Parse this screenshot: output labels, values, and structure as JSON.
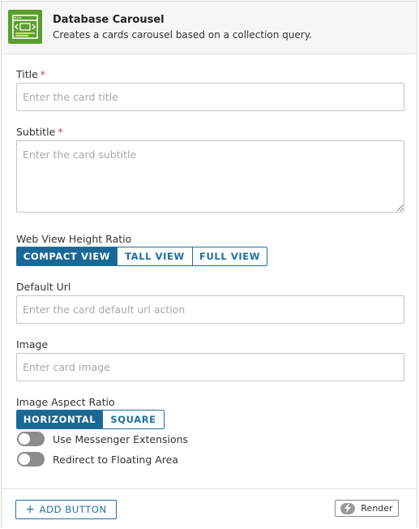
{
  "header": {
    "title": "Database Carousel",
    "description": "Creates a cards carousel based on a collection query."
  },
  "fields": {
    "title": {
      "label": "Title",
      "required_mark": "*",
      "placeholder": "Enter the card title"
    },
    "subtitle": {
      "label": "Subtitle",
      "required_mark": "*",
      "placeholder": "Enter the card subtitle"
    },
    "web_view_height_ratio": {
      "label": "Web View Height Ratio",
      "options": [
        "COMPACT VIEW",
        "TALL VIEW",
        "FULL VIEW"
      ],
      "selected": "COMPACT VIEW"
    },
    "default_url": {
      "label": "Default Url",
      "placeholder": "Enter the card default url action"
    },
    "image": {
      "label": "Image",
      "placeholder": "Enter card image"
    },
    "image_aspect_ratio": {
      "label": "Image Aspect Ratio",
      "options": [
        "HORIZONTAL",
        "SQUARE"
      ],
      "selected": "HORIZONTAL"
    }
  },
  "toggles": {
    "messenger_extensions": {
      "label": "Use Messenger Extensions",
      "on": false
    },
    "floating_area": {
      "label": "Redirect to Floating Area",
      "on": false
    }
  },
  "footer": {
    "add_button_icon": "+",
    "add_button_label": "ADD BUTTON",
    "render_label": "Render",
    "render_icon": "lightning-icon"
  },
  "colors": {
    "accent": "#1b6796",
    "app_icon_bg": "#5c9e2e",
    "required": "#d63b3b",
    "toggle_off": "#8c8c8c"
  }
}
